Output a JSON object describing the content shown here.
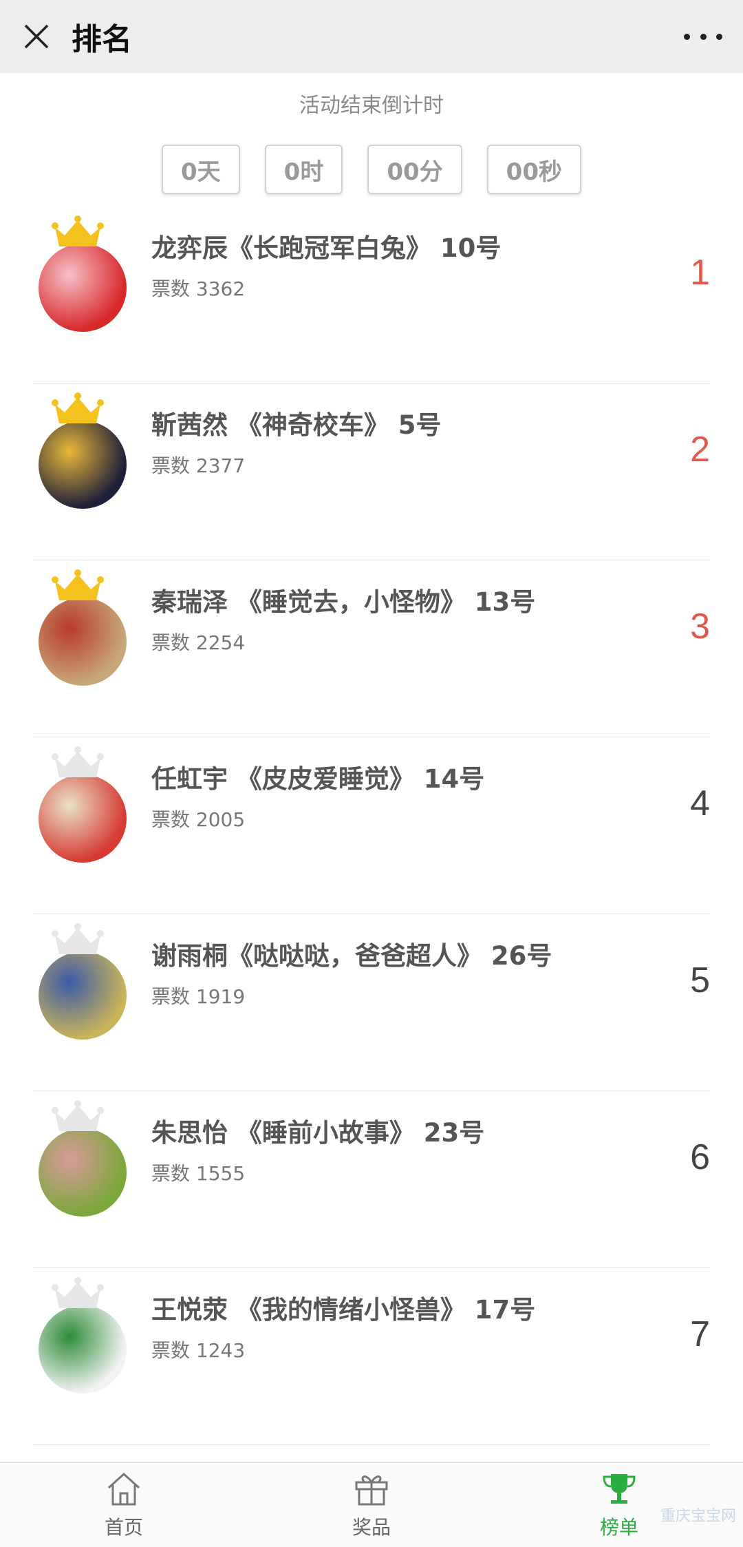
{
  "header": {
    "title": "排名"
  },
  "countdown": {
    "label": "活动结束倒计时",
    "days": "0天",
    "hours": "0时",
    "minutes": "00分",
    "seconds": "00秒"
  },
  "ranking": [
    {
      "name": "龙弈辰《长跑冠军白兔》 10号",
      "votes": "票数 3362",
      "rank": "1",
      "crown": "gold",
      "avatar_colors": [
        "#d8282a",
        "#f7c0c8"
      ]
    },
    {
      "name": "靳茜然 《神奇校车》 5号",
      "votes": "票数 2377",
      "rank": "2",
      "crown": "gold",
      "avatar_colors": [
        "#1f1f3a",
        "#e8b83a"
      ]
    },
    {
      "name": "秦瑞泽 《睡觉去，小怪物》 13号",
      "votes": "票数 2254",
      "rank": "3",
      "crown": "gold",
      "avatar_colors": [
        "#c8a87a",
        "#b83a2a"
      ]
    },
    {
      "name": "任虹宇 《皮皮爱睡觉》 14号",
      "votes": "票数 2005",
      "rank": "4",
      "crown": "gray",
      "avatar_colors": [
        "#d63a32",
        "#e9e2c8"
      ]
    },
    {
      "name": "谢雨桐《哒哒哒，爸爸超人》 26号",
      "votes": "票数 1919",
      "rank": "5",
      "crown": "gray",
      "avatar_colors": [
        "#c9b45a",
        "#3c5aa8"
      ]
    },
    {
      "name": "朱思怡 《睡前小故事》 23号",
      "votes": "票数 1555",
      "rank": "6",
      "crown": "gray",
      "avatar_colors": [
        "#7aa83a",
        "#d89a9a"
      ]
    },
    {
      "name": "王悦荥 《我的情绪小怪兽》 17号",
      "votes": "票数 1243",
      "rank": "7",
      "crown": "gray",
      "avatar_colors": [
        "#f2f2f2",
        "#2e8c3a"
      ]
    }
  ],
  "tabbar": {
    "items": [
      {
        "label": "首页",
        "icon": "home-icon"
      },
      {
        "label": "奖品",
        "icon": "gift-icon"
      },
      {
        "label": "榜单",
        "icon": "trophy-icon"
      }
    ]
  },
  "watermark": "重庆宝宝网",
  "colors": {
    "accent_rank": "#e05a4c",
    "active_tab": "#2aae3f",
    "crown_gold": "#f3c21c"
  }
}
